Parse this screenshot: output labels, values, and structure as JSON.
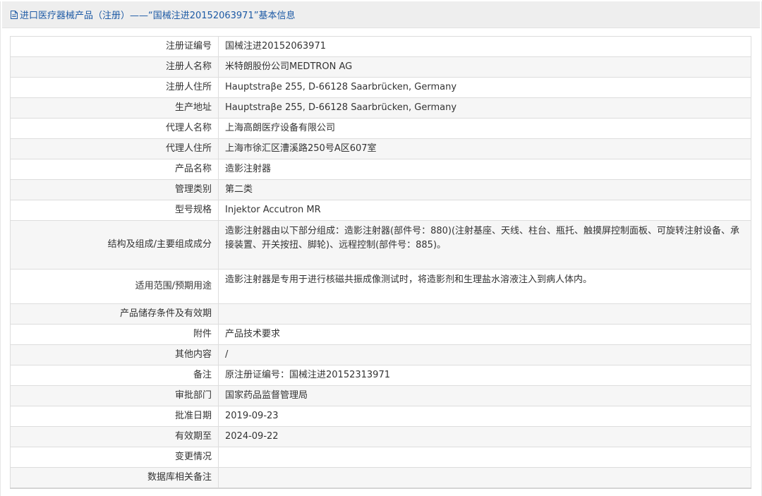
{
  "header": {
    "title": "进口医疗器械产品（注册）——“国械注进20152063971”基本信息",
    "icon": "document-icon",
    "color": "#1d5aa5"
  },
  "rows": [
    {
      "label": "注册证编号",
      "value": "国械注进20152063971"
    },
    {
      "label": "注册人名称",
      "value": "米特朗股份公司MEDTRON AG"
    },
    {
      "label": "注册人住所",
      "value": "Hauptstraβe 255, D-66128 Saarbrücken, Germany"
    },
    {
      "label": "生产地址",
      "value": "Hauptstraβe 255, D-66128 Saarbrücken, Germany"
    },
    {
      "label": "代理人名称",
      "value": "上海高朗医疗设备有限公司"
    },
    {
      "label": "代理人住所",
      "value": "上海市徐汇区漕溪路250号A区607室"
    },
    {
      "label": "产品名称",
      "value": "造影注射器"
    },
    {
      "label": "管理类别",
      "value": "第二类"
    },
    {
      "label": "型号规格",
      "value": "Injektor Accutron MR"
    },
    {
      "label": "结构及组成/主要组成成分",
      "value": "造影注射器由以下部分组成：造影注射器(部件号：880)(注射基座、天线、柱台、瓶托、触摸屏控制面板、可旋转注射设备、承接装置、开关按扭、脚轮)、远程控制(部件号：885)。"
    },
    {
      "label": "适用范围/预期用途",
      "value": "造影注射器是专用于进行核磁共振成像测试时，将造影剂和生理盐水溶液注入到病人体内。"
    },
    {
      "label": "产品储存条件及有效期",
      "value": ""
    },
    {
      "label": "附件",
      "value": "产品技术要求"
    },
    {
      "label": "其他内容",
      "value": "/"
    },
    {
      "label": "备注",
      "value": "原注册证编号：国械注进20152313971"
    },
    {
      "label": "审批部门",
      "value": "国家药品监督管理局"
    },
    {
      "label": "批准日期",
      "value": "2019-09-23"
    },
    {
      "label": "有效期至",
      "value": "2024-09-22"
    },
    {
      "label": "变更情况",
      "value": ""
    },
    {
      "label": "数据库相关备注",
      "value": ""
    }
  ]
}
